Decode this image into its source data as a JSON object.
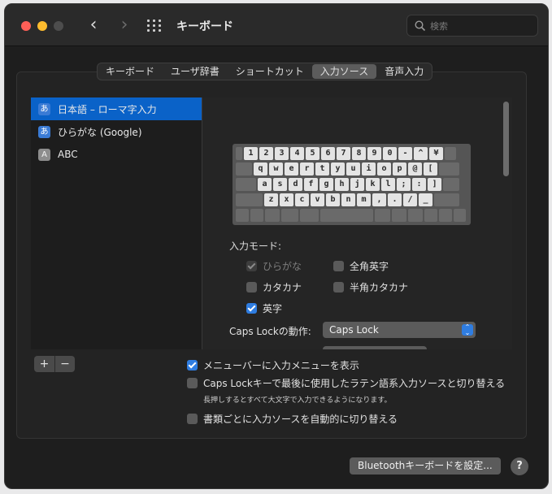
{
  "window": {
    "title": "キーボード"
  },
  "search": {
    "placeholder": "検索"
  },
  "tabs": [
    {
      "label": "キーボード",
      "active": false
    },
    {
      "label": "ユーザ辞書",
      "active": false
    },
    {
      "label": "ショートカット",
      "active": false
    },
    {
      "label": "入力ソース",
      "active": true
    },
    {
      "label": "音声入力",
      "active": false
    }
  ],
  "sources": [
    {
      "label": "日本語 – ローマ字入力",
      "icon": "あ",
      "selected": true
    },
    {
      "label": "ひらがな (Google)",
      "icon": "あ",
      "selected": false
    },
    {
      "label": "ABC",
      "icon": "A",
      "selected": false
    }
  ],
  "keyboard": {
    "row1": [
      "1",
      "2",
      "3",
      "4",
      "5",
      "6",
      "7",
      "8",
      "9",
      "0",
      "-",
      "^",
      "¥"
    ],
    "row2": [
      "q",
      "w",
      "e",
      "r",
      "t",
      "y",
      "u",
      "i",
      "o",
      "p",
      "@",
      "["
    ],
    "row3": [
      "a",
      "s",
      "d",
      "f",
      "g",
      "h",
      "j",
      "k",
      "l",
      ";",
      ":",
      "]"
    ],
    "row4": [
      "z",
      "x",
      "c",
      "v",
      "b",
      "n",
      "m",
      ",",
      ".",
      "/",
      "_"
    ]
  },
  "modes": {
    "label": "入力モード:",
    "hiragana": "ひらがな",
    "zenkaku_eiji": "全角英字",
    "katakana": "カタカナ",
    "hankaku_katakana": "半角カタカナ",
    "eiji": "英字"
  },
  "caps": {
    "label": "Caps Lockの動作:",
    "value": "Caps Lock"
  },
  "options": {
    "show_menu": "メニューバーに入力メニューを表示",
    "caps_switch": "Caps Lockキーで最後に使用したラテン語系入力ソースと切り替える",
    "caps_note": "長押しするとすべて大文字で入力できるようになります。",
    "auto_switch": "書類ごとに入力ソースを自動的に切り替える"
  },
  "buttons": {
    "plus": "+",
    "minus": "−",
    "bluetooth": "Bluetoothキーボードを設定...",
    "help": "?"
  },
  "colors": {
    "accent": "#2f7de1",
    "selection": "#0a62c8"
  }
}
